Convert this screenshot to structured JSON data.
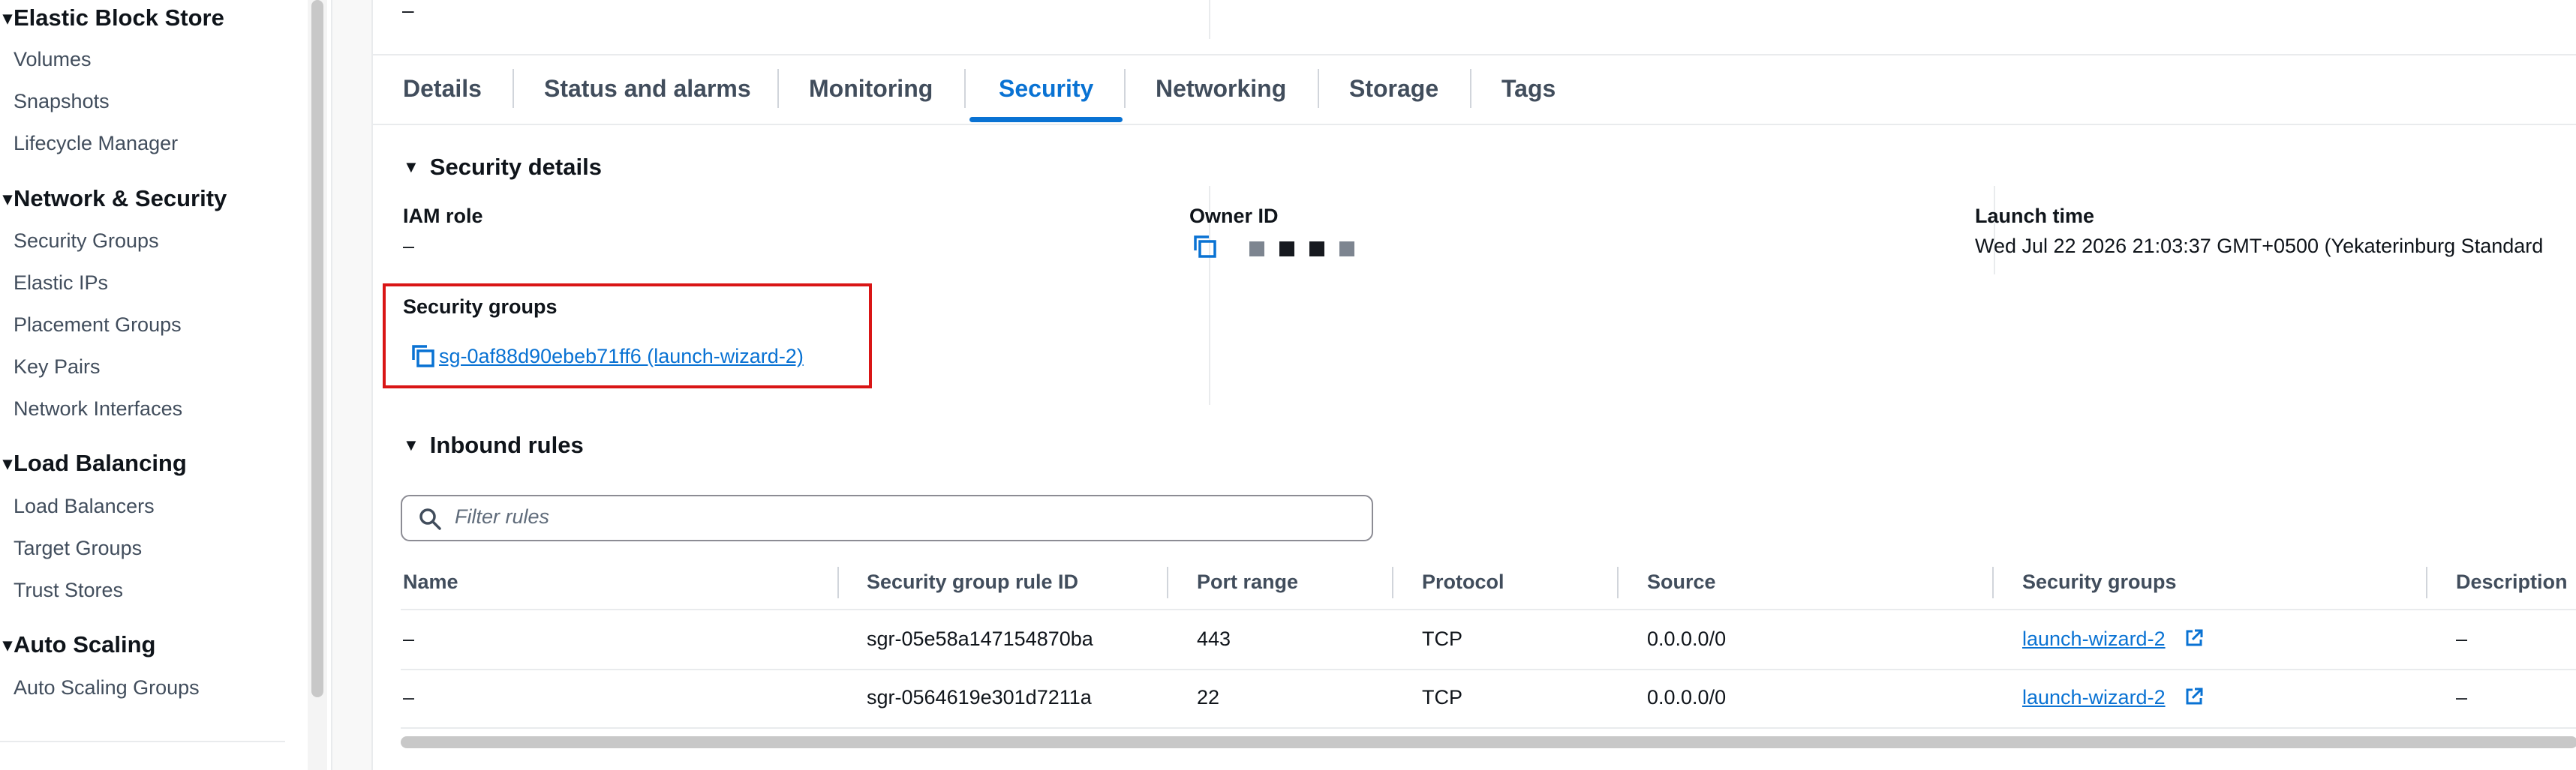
{
  "sidebar": {
    "sections": [
      {
        "title": "Elastic Block Store",
        "items": [
          "Volumes",
          "Snapshots",
          "Lifecycle Manager"
        ]
      },
      {
        "title": "Network & Security",
        "items": [
          "Security Groups",
          "Elastic IPs",
          "Placement Groups",
          "Key Pairs",
          "Network Interfaces"
        ]
      },
      {
        "title": "Load Balancing",
        "items": [
          "Load Balancers",
          "Target Groups",
          "Trust Stores"
        ]
      },
      {
        "title": "Auto Scaling",
        "items": [
          "Auto Scaling Groups"
        ]
      }
    ]
  },
  "top_value": "–",
  "tabs": [
    "Details",
    "Status and alarms",
    "Monitoring",
    "Security",
    "Networking",
    "Storage",
    "Tags"
  ],
  "active_tab": "Security",
  "security_details": {
    "heading": "Security details",
    "iam_role_label": "IAM role",
    "iam_role_value": "–",
    "owner_id_label": "Owner ID",
    "launch_time_label": "Launch time",
    "launch_time_value": "Wed Jul 22 2026 21:03:37 GMT+0500 (Yekaterinburg Standard",
    "security_groups_label": "Security groups",
    "security_group_link": "sg-0af88d90ebeb71ff6 (launch-wizard-2)"
  },
  "inbound_rules": {
    "heading": "Inbound rules",
    "filter_placeholder": "Filter rules",
    "columns": [
      "Name",
      "Security group rule ID",
      "Port range",
      "Protocol",
      "Source",
      "Security groups",
      "Description"
    ],
    "rows": [
      {
        "name": "–",
        "rule_id": "sgr-05e58a147154870ba",
        "port_range": "443",
        "protocol": "TCP",
        "source": "0.0.0.0/0",
        "security_group": "launch-wizard-2",
        "description": "–"
      },
      {
        "name": "–",
        "rule_id": "sgr-0564619e301d7211a",
        "port_range": "22",
        "protocol": "TCP",
        "source": "0.0.0.0/0",
        "security_group": "launch-wizard-2",
        "description": "–"
      }
    ]
  },
  "colors": {
    "link": "#0972d3",
    "highlight_box": "#d91515",
    "heading_text": "#0f141a",
    "secondary_text": "#414d5c"
  }
}
